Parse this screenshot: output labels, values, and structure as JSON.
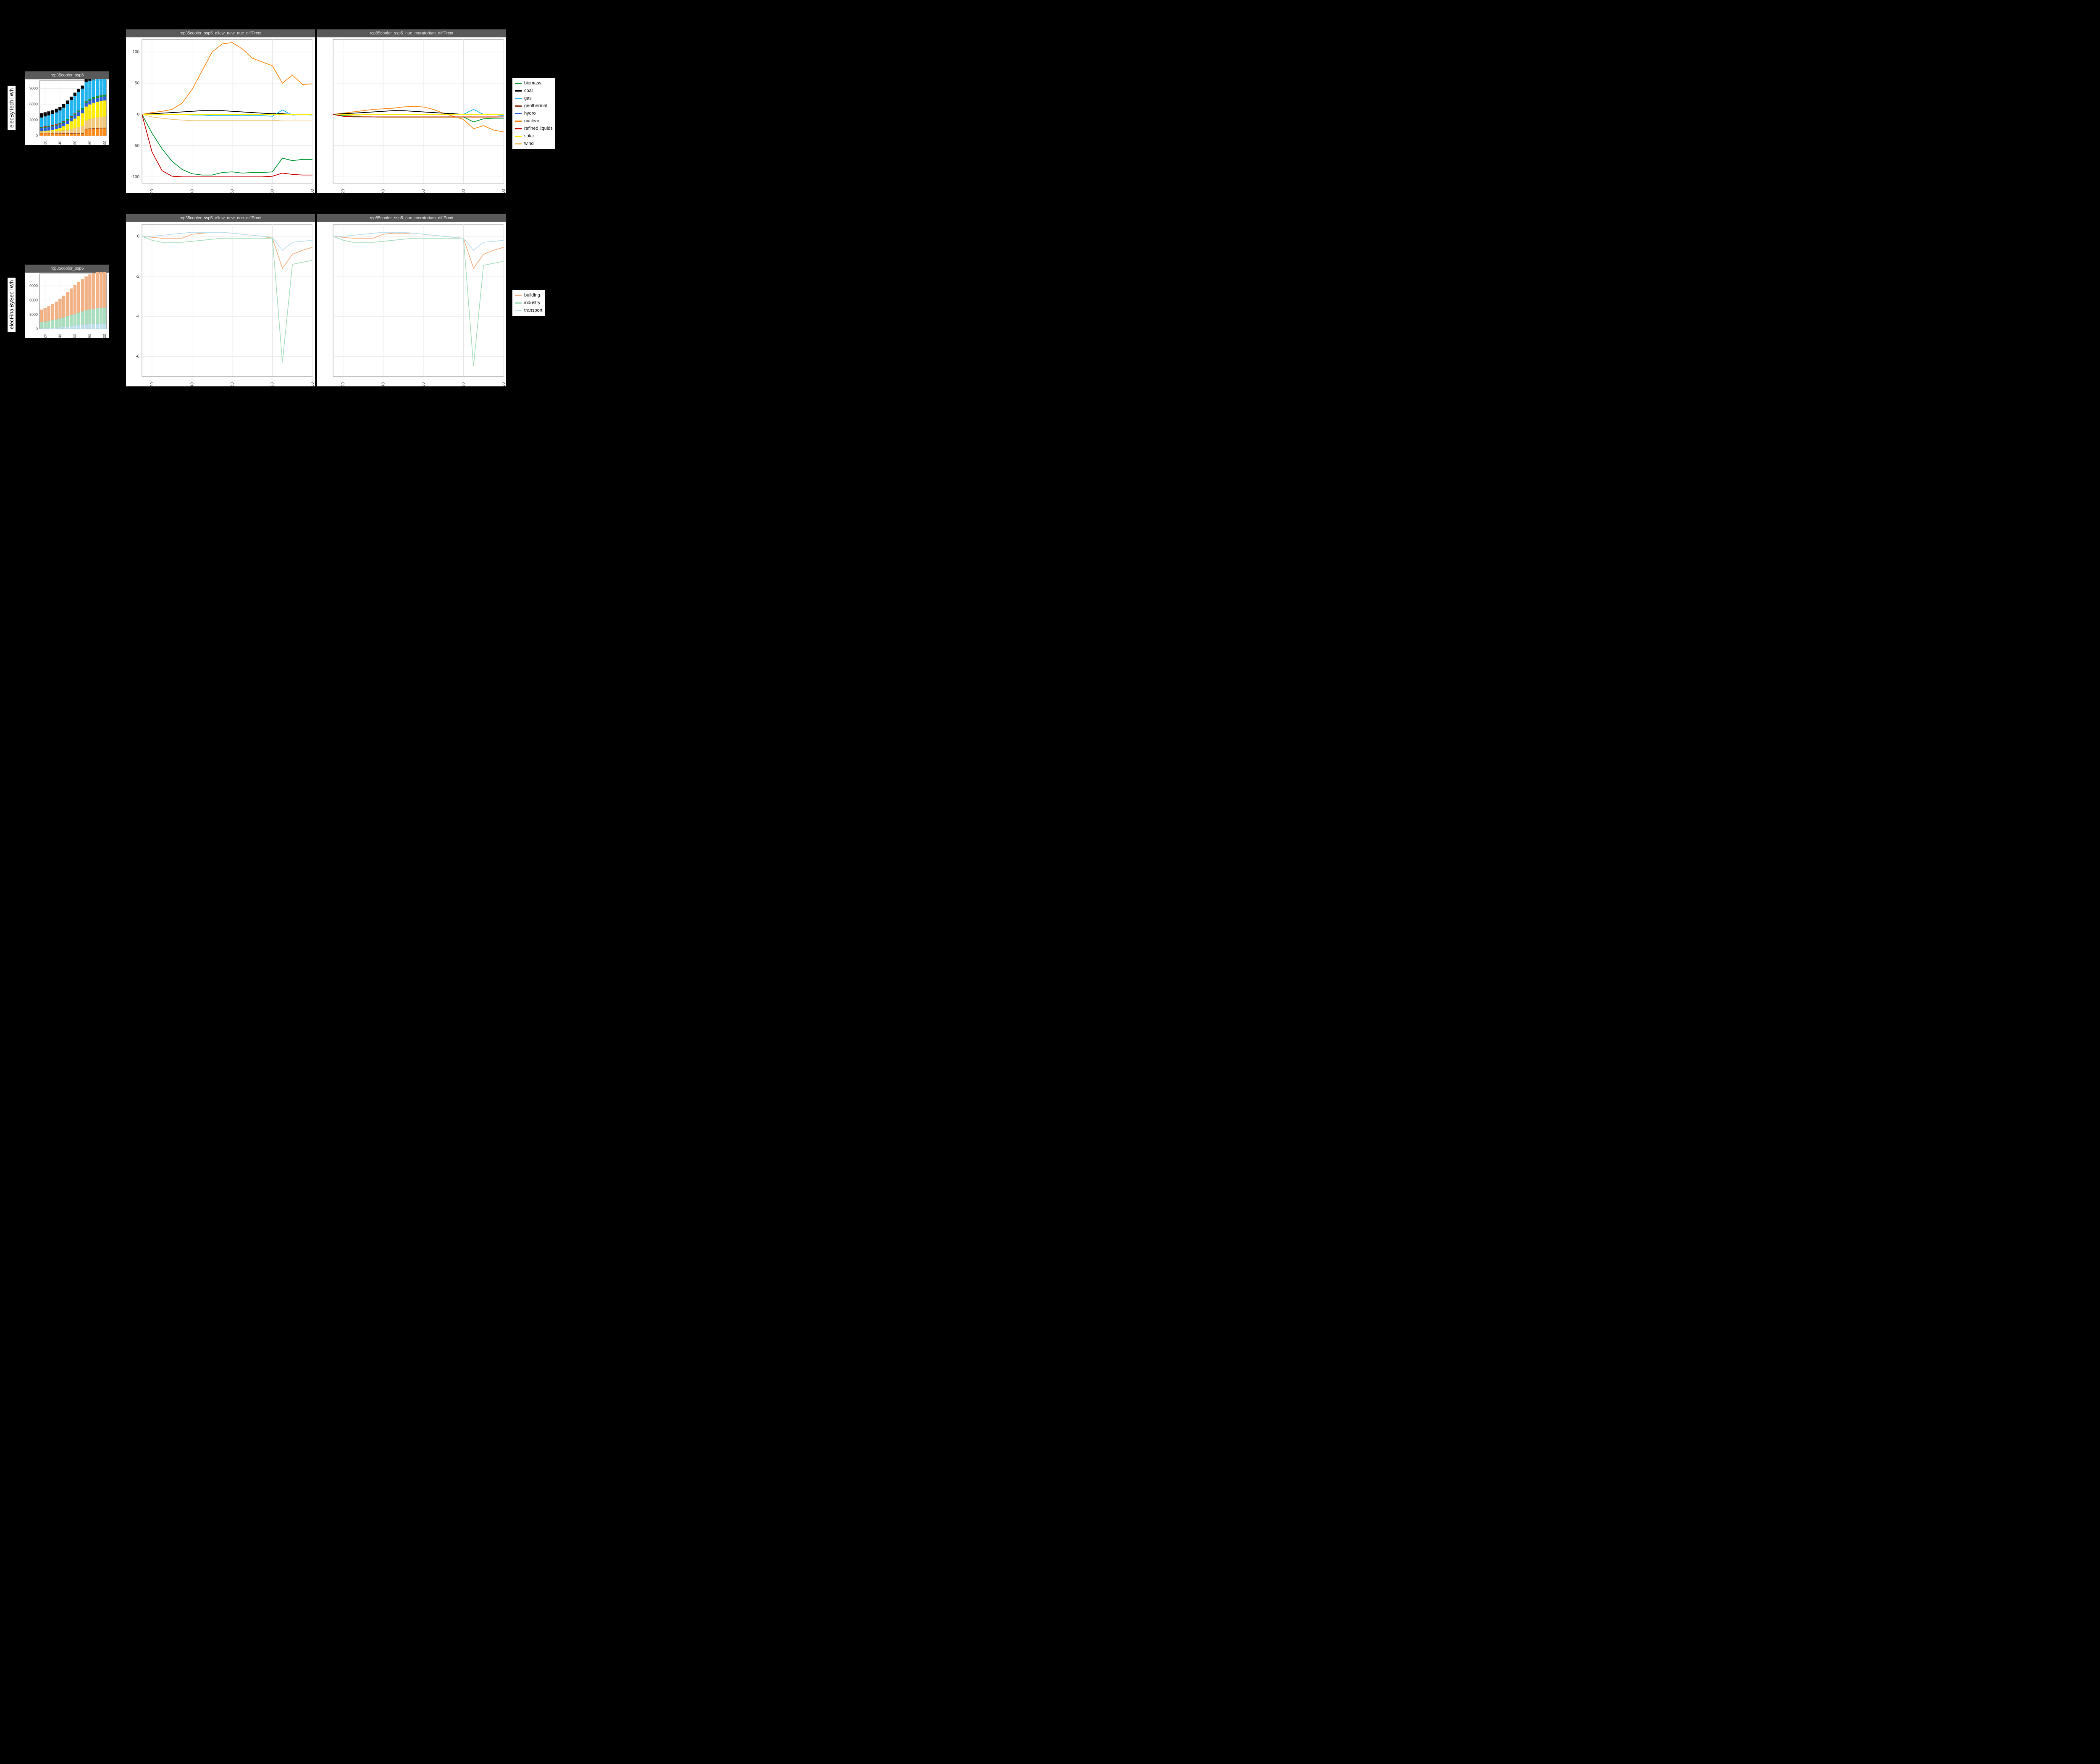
{
  "colors_tech": {
    "biomass": "#009933",
    "coal": "#000000",
    "gas": "#1fb5f0",
    "geothermal": "#8B3A1A",
    "hydro": "#2a5fd9",
    "nuclear": "#ff8c1a",
    "refined liquids": "#cc0000",
    "solar": "#ffee00",
    "wind": "#f2c879"
  },
  "colors_sec": {
    "building": "#f4b183",
    "industry": "#a9dfbf",
    "transport": "#bfe0ef"
  },
  "x_years": [
    2015,
    2020,
    2025,
    2030,
    2035,
    2040,
    2045,
    2050,
    2055,
    2060,
    2065,
    2070,
    2075,
    2080,
    2085,
    2090,
    2095,
    2100
  ],
  "row1": {
    "ylab": "elecByTechTWh",
    "mini": {
      "title": "rcp85cooler_ssp5",
      "ylim": [
        0,
        10500
      ],
      "yticks": [
        0,
        3000,
        6000,
        9000
      ],
      "xticks": [
        2020,
        2040,
        2060,
        2080,
        2100
      ],
      "stack_order": [
        "nuclear",
        "geothermal",
        "wind",
        "solar",
        "hydro",
        "biomass",
        "refined liquids",
        "gas",
        "coal"
      ],
      "stack": {
        "nuclear": [
          450,
          460,
          450,
          440,
          430,
          420,
          410,
          400,
          390,
          380,
          370,
          360,
          1200,
          1250,
          1300,
          1350,
          1380,
          1400
        ],
        "geothermal": [
          50,
          55,
          60,
          65,
          70,
          75,
          80,
          85,
          90,
          95,
          100,
          105,
          110,
          115,
          120,
          125,
          130,
          135
        ],
        "wind": [
          200,
          230,
          260,
          300,
          350,
          420,
          520,
          650,
          800,
          980,
          1150,
          1350,
          1550,
          1750,
          1900,
          2000,
          2050,
          2100
        ],
        "solar": [
          120,
          160,
          220,
          300,
          420,
          580,
          800,
          1100,
          1450,
          1800,
          2150,
          2450,
          2700,
          2850,
          2950,
          3000,
          3050,
          3080
        ],
        "hydro": [
          600,
          610,
          620,
          630,
          640,
          650,
          660,
          670,
          680,
          690,
          700,
          710,
          720,
          730,
          740,
          750,
          760,
          770
        ],
        "biomass": [
          150,
          160,
          170,
          180,
          190,
          200,
          210,
          220,
          230,
          240,
          250,
          260,
          270,
          280,
          290,
          300,
          310,
          320
        ],
        "refined liquids": [
          100,
          95,
          90,
          85,
          80,
          75,
          70,
          65,
          60,
          55,
          50,
          45,
          40,
          35,
          30,
          25,
          20,
          15
        ],
        "gas": [
          1800,
          1900,
          2000,
          2100,
          2250,
          2400,
          2600,
          2850,
          3100,
          3350,
          3550,
          3700,
          3600,
          3500,
          3400,
          3350,
          3300,
          3280
        ],
        "coal": [
          800,
          780,
          760,
          740,
          720,
          700,
          680,
          660,
          640,
          620,
          600,
          580,
          560,
          540,
          530,
          520,
          510,
          500
        ]
      }
    },
    "big": {
      "ylim": [
        -110,
        120
      ],
      "yticks": [
        -100,
        -50,
        0,
        50,
        100
      ],
      "xticks": [
        2020,
        2040,
        2060,
        2080,
        2100
      ],
      "facets": [
        {
          "title": "rcp85cooler_ssp5_allow_new_nuc_diffPrcnt",
          "series": {
            "nuclear": [
              0,
              3,
              5,
              8,
              18,
              40,
              70,
              100,
              113,
              115,
              105,
              90,
              84,
              78,
              50,
              63,
              48,
              49,
              43
            ],
            "coal": [
              0,
              1,
              2,
              3,
              4,
              5,
              6,
              6,
              6,
              5,
              4,
              3,
              2,
              1,
              1,
              0,
              0,
              0
            ],
            "gas": [
              0,
              0,
              0,
              0,
              0,
              -1,
              -1,
              -2,
              -2,
              -2,
              -2,
              -2,
              -2,
              -3,
              7,
              -1,
              0,
              -1
            ],
            "hydro": [
              0,
              0,
              0,
              0,
              0,
              0,
              0,
              0,
              0,
              0,
              0,
              0,
              0,
              0,
              0,
              0,
              0,
              0
            ],
            "geothermal": [
              0,
              0,
              0,
              0,
              0,
              0,
              0,
              0,
              0,
              0,
              0,
              0,
              0,
              0,
              0,
              0,
              0,
              0
            ],
            "solar": [
              0,
              0,
              0,
              0,
              0,
              0,
              0,
              0,
              0,
              0,
              0,
              0,
              0,
              0,
              0,
              0,
              0,
              0
            ],
            "wind": [
              0,
              -4,
              -6,
              -8,
              -9,
              -10,
              -10,
              -10,
              -10,
              -10,
              -10,
              -10,
              -10,
              -10,
              -9,
              -9,
              -9,
              -9
            ],
            "biomass": [
              0,
              -30,
              -55,
              -75,
              -88,
              -95,
              -97,
              -97,
              -93,
              -92,
              -94,
              -93,
              -93,
              -92,
              -70,
              -74,
              -72,
              -72,
              -70
            ],
            "refined liquids": [
              0,
              -60,
              -90,
              -99,
              -100,
              -100,
              -100,
              -100,
              -100,
              -100,
              -100,
              -100,
              -100,
              -99,
              -94,
              -96,
              -97,
              -97,
              -97
            ]
          }
        },
        {
          "title": "rcp85cooler_ssp5_nuc_moratorium_diffPrcnt",
          "series": {
            "nuclear": [
              0,
              2,
              4,
              6,
              8,
              9,
              10,
              12,
              13,
              12,
              8,
              2,
              -3,
              -8,
              -23,
              -18,
              -25,
              -28,
              -29
            ],
            "coal": [
              0,
              1,
              2,
              3,
              4,
              5,
              6,
              6,
              5,
              4,
              3,
              2,
              1,
              0,
              0,
              0,
              0,
              0
            ],
            "gas": [
              0,
              0,
              0,
              0,
              0,
              0,
              0,
              0,
              0,
              0,
              0,
              0,
              0,
              0,
              8,
              0,
              0,
              -2
            ],
            "hydro": [
              0,
              0,
              0,
              0,
              0,
              0,
              0,
              0,
              0,
              0,
              0,
              0,
              0,
              0,
              0,
              0,
              0,
              0
            ],
            "geothermal": [
              0,
              0,
              0,
              0,
              0,
              0,
              0,
              0,
              0,
              0,
              0,
              0,
              0,
              0,
              0,
              0,
              0,
              0
            ],
            "solar": [
              0,
              0,
              0,
              0,
              0,
              0,
              0,
              0,
              0,
              0,
              0,
              0,
              0,
              0,
              0,
              0,
              0,
              0
            ],
            "wind": [
              0,
              -1,
              -2,
              -3,
              -4,
              -5,
              -5,
              -5,
              -5,
              -5,
              -5,
              -5,
              -5,
              -5,
              -5,
              -5,
              -5,
              -6
            ],
            "biomass": [
              0,
              -2,
              -3,
              -4,
              -4,
              -4,
              -4,
              -4,
              -4,
              -4,
              -4,
              -4,
              -4,
              -4,
              -12,
              -7,
              -6,
              -6,
              -6
            ],
            "refined liquids": [
              0,
              -3,
              -4,
              -4,
              -4,
              -4,
              -4,
              -4,
              -4,
              -4,
              -4,
              -4,
              -4,
              -4,
              -4,
              -4,
              -4,
              -4
            ]
          }
        }
      ]
    }
  },
  "row2": {
    "ylab": "elecFinalBySecTWh",
    "mini": {
      "title": "rcp85cooler_ssp5",
      "ylim": [
        0,
        11500
      ],
      "yticks": [
        0,
        3000,
        6000,
        9000
      ],
      "xticks": [
        2020,
        2040,
        2060,
        2080,
        2100
      ],
      "stack_order": [
        "transport",
        "industry",
        "building"
      ],
      "stack": {
        "transport": [
          120,
          140,
          170,
          210,
          260,
          320,
          400,
          490,
          590,
          690,
          790,
          880,
          960,
          1020,
          1060,
          1090,
          1110,
          1130
        ],
        "industry": [
          1300,
          1400,
          1500,
          1600,
          1720,
          1850,
          1990,
          2140,
          2300,
          2460,
          2620,
          2780,
          2930,
          3050,
          3150,
          3230,
          3290,
          3340
        ],
        "building": [
          2600,
          2800,
          3050,
          3350,
          3700,
          4100,
          4550,
          5050,
          5550,
          6000,
          6400,
          6750,
          7050,
          7300,
          7500,
          7650,
          7780,
          7900
        ]
      }
    },
    "big": {
      "ylim": [
        -7,
        0.6
      ],
      "yticks": [
        -6,
        -4,
        -2,
        0
      ],
      "xticks": [
        2020,
        2040,
        2060,
        2080,
        2100
      ],
      "facets": [
        {
          "title": "rcp85cooler_ssp5_allow_new_nuc_diffPrcnt",
          "series": {
            "building": [
              0,
              -0.05,
              -0.1,
              -0.1,
              -0.1,
              0.1,
              0.15,
              0.2,
              0.2,
              0.15,
              0.1,
              0.05,
              0.0,
              -0.1,
              -1.6,
              -0.9,
              -0.7,
              -0.55,
              -0.5
            ],
            "industry": [
              0,
              -0.2,
              -0.3,
              -0.3,
              -0.3,
              -0.25,
              -0.2,
              -0.15,
              -0.1,
              -0.1,
              -0.1,
              -0.1,
              -0.1,
              -0.1,
              -6.3,
              -1.4,
              -1.3,
              -1.2,
              -1.15
            ],
            "transport": [
              0,
              0,
              0.05,
              0.1,
              0.15,
              0.2,
              0.2,
              0.2,
              0.2,
              0.15,
              0.1,
              0.05,
              0.0,
              -0.05,
              -0.7,
              -0.3,
              -0.25,
              -0.2,
              -0.15
            ]
          }
        },
        {
          "title": "rcp85cooler_ssp5_nuc_moratorium_diffPrcnt",
          "series": {
            "building": [
              0,
              -0.05,
              -0.1,
              -0.1,
              -0.1,
              0.1,
              0.15,
              0.15,
              0.15,
              0.1,
              0.05,
              0.0,
              -0.05,
              -0.1,
              -1.6,
              -0.9,
              -0.7,
              -0.55,
              -0.5
            ],
            "industry": [
              0,
              -0.2,
              -0.3,
              -0.3,
              -0.3,
              -0.25,
              -0.2,
              -0.15,
              -0.1,
              -0.1,
              -0.1,
              -0.1,
              -0.1,
              -0.1,
              -6.5,
              -1.45,
              -1.35,
              -1.25,
              -1.2
            ],
            "transport": [
              0,
              0,
              0.05,
              0.1,
              0.15,
              0.2,
              0.2,
              0.2,
              0.15,
              0.1,
              0.05,
              0.0,
              -0.05,
              -0.1,
              -0.7,
              -0.3,
              -0.25,
              -0.2,
              -0.15
            ]
          }
        }
      ]
    }
  },
  "legend_tech": [
    "biomass",
    "coal",
    "gas",
    "geothermal",
    "hydro",
    "nuclear",
    "refined liquids",
    "solar",
    "wind"
  ],
  "legend_sec": [
    "building",
    "industry",
    "transport"
  ],
  "chart_data": {
    "note": "Six facetted ggplot panels. Two rows: row1=electricity generation by technology (left thumbnail stacked-bar TWh, right two facets % difference lines). row2=final electricity by sector (left thumbnail stacked-bar TWh, right two facets % difference lines).",
    "charts": [
      {
        "id": "row1_mini",
        "type": "stacked_bar",
        "title": "rcp85cooler_ssp5",
        "ylabel": "elecByTechTWh",
        "x": "x_years",
        "series_ref": "row1.mini.stack",
        "ylim": [
          0,
          10500
        ]
      },
      {
        "id": "row1_facet1",
        "type": "line",
        "title": "rcp85cooler_ssp5_allow_new_nuc_diffPrcnt",
        "x": "x_years",
        "series_ref": "row1.big.facets.0.series",
        "ylim": [
          -110,
          120
        ]
      },
      {
        "id": "row1_facet2",
        "type": "line",
        "title": "rcp85cooler_ssp5_nuc_moratorium_diffPrcnt",
        "x": "x_years",
        "series_ref": "row1.big.facets.1.series",
        "ylim": [
          -110,
          120
        ]
      },
      {
        "id": "row2_mini",
        "type": "stacked_bar",
        "title": "rcp85cooler_ssp5",
        "ylabel": "elecFinalBySecTWh",
        "x": "x_years",
        "series_ref": "row2.mini.stack",
        "ylim": [
          0,
          11500
        ]
      },
      {
        "id": "row2_facet1",
        "type": "line",
        "title": "rcp85cooler_ssp5_allow_new_nuc_diffPrcnt",
        "x": "x_years",
        "series_ref": "row2.big.facets.0.series",
        "ylim": [
          -7,
          0.6
        ]
      },
      {
        "id": "row2_facet2",
        "type": "line",
        "title": "rcp85cooler_ssp5_nuc_moratorium_diffPrcnt",
        "x": "x_years",
        "series_ref": "row2.big.facets.1.series",
        "ylim": [
          -7,
          0.6
        ]
      }
    ]
  }
}
